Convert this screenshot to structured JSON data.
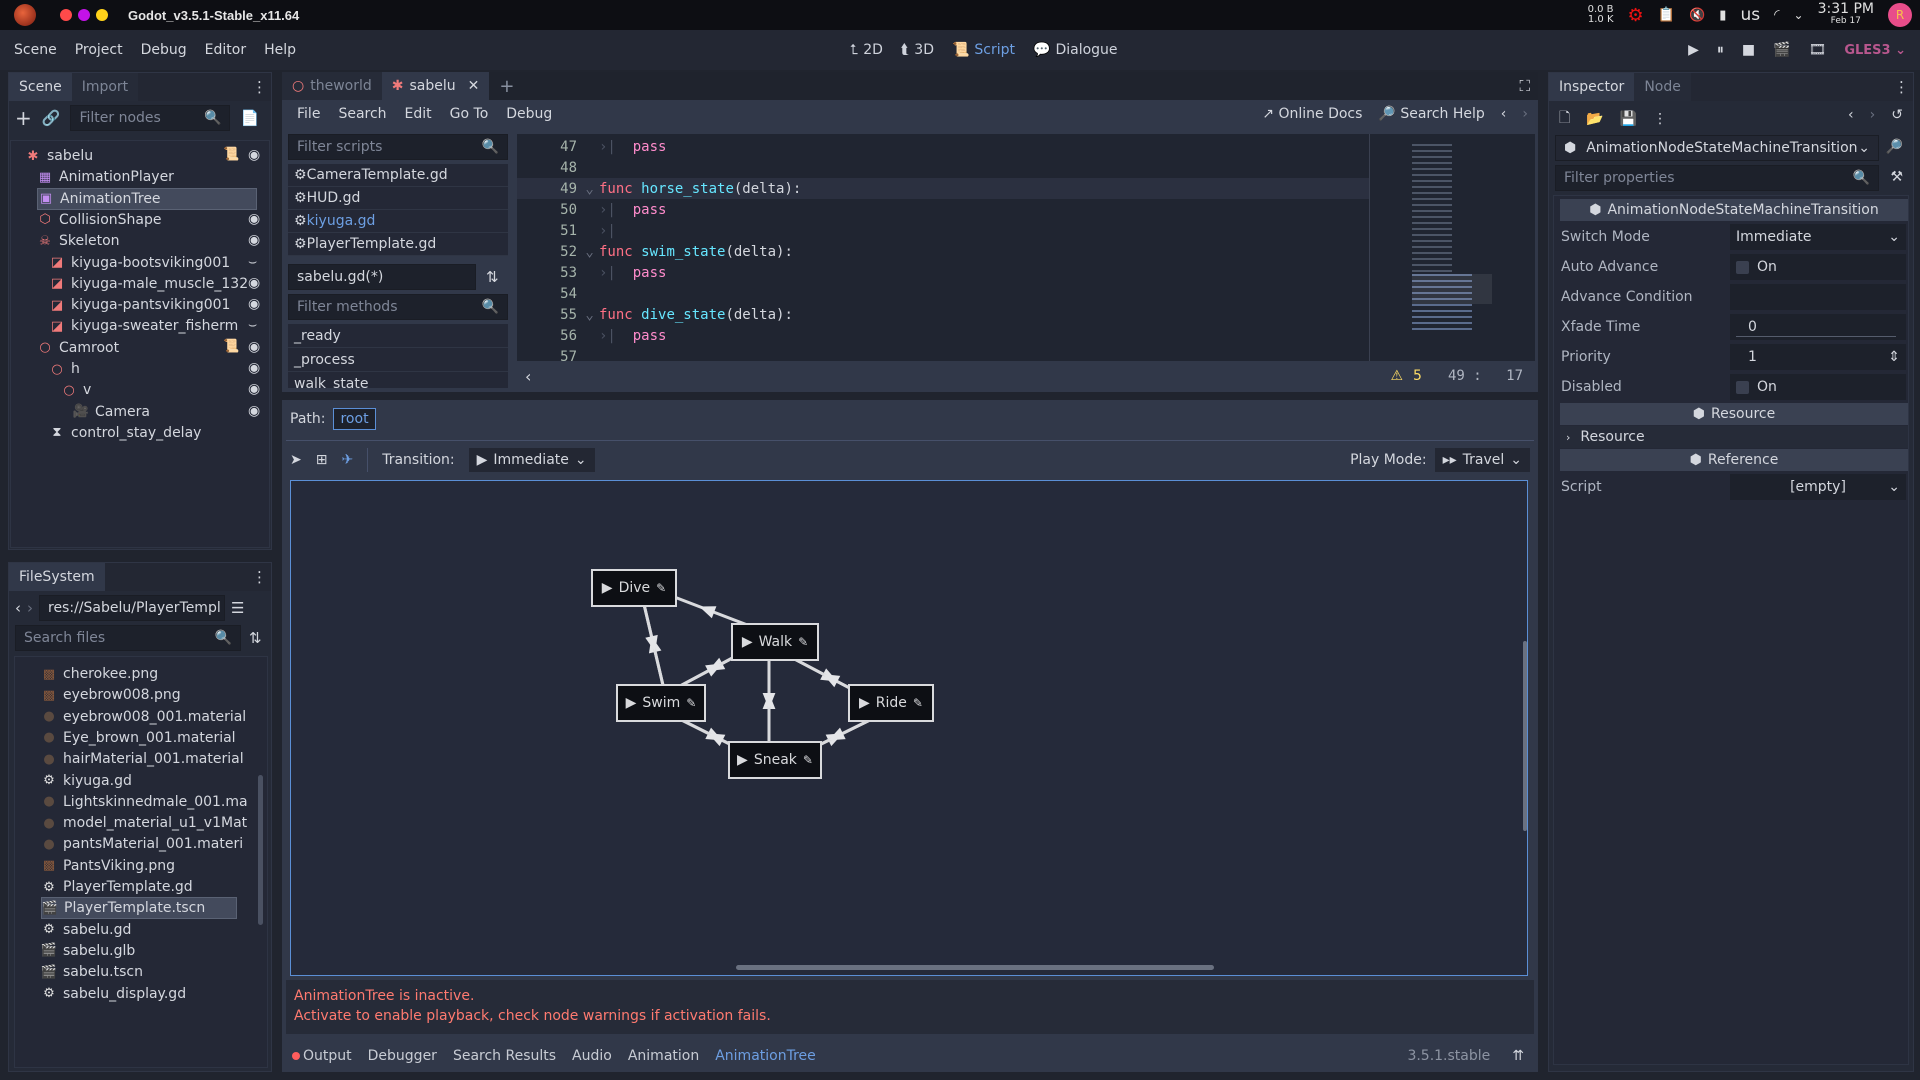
{
  "system": {
    "window_title": "Godot_v3.5.1-Stable_x11.64",
    "traffic_colors": [
      "#ff4a4a",
      "#c312e8",
      "#ffd21a"
    ],
    "net_up": "0.0 B",
    "net_down": "1.0 K",
    "keyboard": "us",
    "time": "3:31 PM",
    "date": "Feb 17",
    "avatar_letter": "R"
  },
  "menubar": {
    "menus": [
      "Scene",
      "Project",
      "Debug",
      "Editor",
      "Help"
    ],
    "modes": [
      {
        "label": "2D",
        "icon": "2d-icon"
      },
      {
        "label": "3D",
        "icon": "3d-icon"
      },
      {
        "label": "Script",
        "icon": "script-icon",
        "active": true
      },
      {
        "label": "Dialogue",
        "icon": "dialogue-icon"
      }
    ],
    "renderer": "GLES3"
  },
  "scene_dock": {
    "tabs": [
      "Scene",
      "Import"
    ],
    "filter_placeholder": "Filter nodes",
    "nodes": [
      {
        "name": "sabelu",
        "depth": 0,
        "icon": "kinematic-body-icon",
        "script": true,
        "visible": "eye"
      },
      {
        "name": "AnimationPlayer",
        "depth": 1,
        "icon": "animation-player-icon"
      },
      {
        "name": "AnimationTree",
        "depth": 1,
        "icon": "animation-tree-icon",
        "selected": true
      },
      {
        "name": "CollisionShape",
        "depth": 1,
        "icon": "collision-shape-icon",
        "visible": "eye"
      },
      {
        "name": "Skeleton",
        "depth": 1,
        "icon": "skeleton-icon",
        "visible": "eye"
      },
      {
        "name": "kiyuga-bootsviking001",
        "depth": 2,
        "icon": "mesh-instance-icon",
        "visible": "hidden"
      },
      {
        "name": "kiyuga-male_muscle_132",
        "depth": 2,
        "icon": "mesh-instance-icon",
        "visible": "eye"
      },
      {
        "name": "kiyuga-pantsviking001",
        "depth": 2,
        "icon": "mesh-instance-icon",
        "visible": "eye"
      },
      {
        "name": "kiyuga-sweater_fisherm",
        "depth": 2,
        "icon": "mesh-instance-icon",
        "visible": "hidden"
      },
      {
        "name": "Camroot",
        "depth": 1,
        "icon": "spatial-icon",
        "script": true,
        "visible": "eye"
      },
      {
        "name": "h",
        "depth": 2,
        "icon": "spatial-icon",
        "visible": "eye"
      },
      {
        "name": "v",
        "depth": 3,
        "icon": "spatial-icon",
        "visible": "eye"
      },
      {
        "name": "Camera",
        "depth": 4,
        "icon": "camera-icon",
        "visible": "eye"
      },
      {
        "name": "control_stay_delay",
        "depth": 2,
        "icon": "timer-icon"
      }
    ]
  },
  "filesystem": {
    "tab": "FileSystem",
    "path": "res://Sabelu/PlayerTempl",
    "search_placeholder": "Search files",
    "files": [
      {
        "name": "cherokee.png",
        "icon": "texture-thumb-icon"
      },
      {
        "name": "eyebrow008.png",
        "icon": "texture-thumb-icon"
      },
      {
        "name": "eyebrow008_001.material",
        "icon": "material-icon"
      },
      {
        "name": "Eye_brown_001.material",
        "icon": "material-icon"
      },
      {
        "name": "hairMaterial_001.material",
        "icon": "material-icon"
      },
      {
        "name": "kiyuga.gd",
        "icon": "gear-icon"
      },
      {
        "name": "Lightskinnedmale_001.ma",
        "icon": "material-icon"
      },
      {
        "name": "model_material_u1_v1Mat",
        "icon": "material-icon"
      },
      {
        "name": "pantsMaterial_001.materi",
        "icon": "material-icon"
      },
      {
        "name": "PantsViking.png",
        "icon": "texture-thumb-icon"
      },
      {
        "name": "PlayerTemplate.gd",
        "icon": "gear-icon"
      },
      {
        "name": "PlayerTemplate.tscn",
        "icon": "scene-icon",
        "selected": true
      },
      {
        "name": "sabelu.gd",
        "icon": "gear-icon"
      },
      {
        "name": "sabelu.glb",
        "icon": "scene-icon"
      },
      {
        "name": "sabelu.tscn",
        "icon": "scene-icon"
      },
      {
        "name": "sabelu_display.gd",
        "icon": "gear-icon"
      }
    ]
  },
  "editor_tabs": [
    {
      "label": "theworld",
      "icon": "spatial-icon"
    },
    {
      "label": "sabelu",
      "icon": "kinematic-body-icon",
      "active": true
    }
  ],
  "script_editor": {
    "menus": [
      "File",
      "Search",
      "Edit",
      "Go To",
      "Debug"
    ],
    "online_docs": "Online Docs",
    "search_help": "Search Help",
    "filter_scripts_placeholder": "Filter scripts",
    "scripts": [
      "CameraTemplate.gd",
      "HUD.gd",
      "kiyuga.gd",
      "PlayerTemplate.gd"
    ],
    "active_script_index": 2,
    "current_file": "sabelu.gd(*)",
    "filter_methods_placeholder": "Filter methods",
    "methods": [
      "_ready",
      "_process",
      "walk_state"
    ],
    "code": [
      {
        "n": "47",
        "indent": true,
        "kw": "",
        "fn": "",
        "rest": "pass"
      },
      {
        "n": "48",
        "indent": false,
        "kw": "",
        "fn": "",
        "rest": ""
      },
      {
        "n": "49",
        "fold": true,
        "kw": "func",
        "fn": "horse_state",
        "rest": "(delta):",
        "current": true
      },
      {
        "n": "50",
        "indent": true,
        "kw": "",
        "fn": "",
        "rest": "pass"
      },
      {
        "n": "51",
        "indent": true,
        "kw": "",
        "fn": "",
        "rest": ""
      },
      {
        "n": "52",
        "fold": true,
        "kw": "func",
        "fn": "swim_state",
        "rest": "(delta):"
      },
      {
        "n": "53",
        "indent": true,
        "kw": "",
        "fn": "",
        "rest": "pass"
      },
      {
        "n": "54",
        "indent": false,
        "kw": "",
        "fn": "",
        "rest": ""
      },
      {
        "n": "55",
        "fold": true,
        "kw": "func",
        "fn": "dive_state",
        "rest": "(delta):"
      },
      {
        "n": "56",
        "indent": true,
        "kw": "",
        "fn": "",
        "rest": "pass"
      },
      {
        "n": "57",
        "indent": false,
        "kw": "",
        "fn": "",
        "rest": ""
      }
    ],
    "warnings": "5",
    "cursor_line": "49",
    "cursor_sep": ":",
    "cursor_col": "17"
  },
  "anim_tree": {
    "path_label": "Path:",
    "path_value": "root",
    "transition_label": "Transition:",
    "transition_value": "Immediate",
    "play_mode_label": "Play Mode:",
    "play_mode_value": "Travel",
    "states": [
      {
        "id": "Dive",
        "label": "Dive"
      },
      {
        "id": "Walk",
        "label": "Walk"
      },
      {
        "id": "Swim",
        "label": "Swim"
      },
      {
        "id": "Ride",
        "label": "Ride"
      },
      {
        "id": "Sneak",
        "label": "Sneak"
      }
    ],
    "transitions": [
      [
        "Walk",
        "Dive"
      ],
      [
        "Swim",
        "Dive"
      ],
      [
        "Dive",
        "Swim"
      ],
      [
        "Walk",
        "Swim"
      ],
      [
        "Swim",
        "Walk"
      ],
      [
        "Walk",
        "Ride"
      ],
      [
        "Ride",
        "Walk"
      ],
      [
        "Sneak",
        "Walk"
      ],
      [
        "Walk",
        "Sneak"
      ],
      [
        "Swim",
        "Sneak"
      ],
      [
        "Sneak",
        "Swim"
      ],
      [
        "Sneak",
        "Ride"
      ],
      [
        "Ride",
        "Sneak"
      ]
    ],
    "warning_line1": "AnimationTree is inactive.",
    "warning_line2": "Activate to enable playback, check node warnings if activation fails."
  },
  "bottom_panel": {
    "tabs": [
      "Output",
      "Debugger",
      "Search Results",
      "Audio",
      "Animation",
      "AnimationTree"
    ],
    "active_tab": "AnimationTree",
    "version": "3.5.1.stable"
  },
  "inspector": {
    "tabs": [
      "Inspector",
      "Node"
    ],
    "object_type": "AnimationNodeStateMachineTransition",
    "filter_placeholder": "Filter properties",
    "section_title": "AnimationNodeStateMachineTransition",
    "props": {
      "switch_mode_label": "Switch Mode",
      "switch_mode_value": "Immediate",
      "auto_advance_label": "Auto Advance",
      "auto_advance_value": "On",
      "auto_advance_checked": false,
      "advance_condition_label": "Advance Condition",
      "advance_condition_value": "",
      "xfade_label": "Xfade Time",
      "xfade_value": "0",
      "priority_label": "Priority",
      "priority_value": "1",
      "disabled_label": "Disabled",
      "disabled_value": "On",
      "disabled_checked": false
    },
    "resource_section": "Resource",
    "resource_group": "Resource",
    "reference_section": "Reference",
    "script_label": "Script",
    "script_value": "[empty]"
  }
}
